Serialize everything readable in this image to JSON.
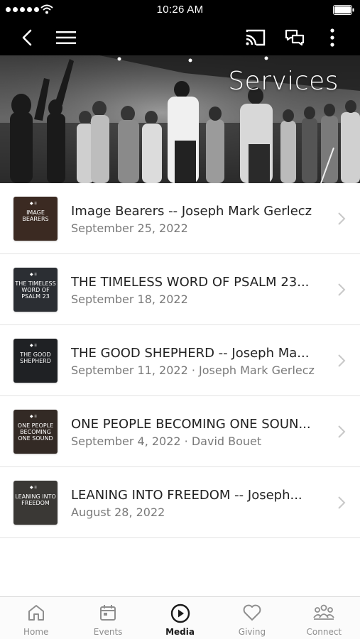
{
  "status_bar": {
    "time": "10:26 AM"
  },
  "page": {
    "title": "Services"
  },
  "items": [
    {
      "title": "Image Bearers -- Joseph Mark Gerlecz",
      "subtitle": "September 25, 2022",
      "thumb_text": "IMAGE BEARERS",
      "thumb_color": "#3b2a22"
    },
    {
      "title": "THE TIMELESS WORD OF PSALM 23...",
      "subtitle": "September 18, 2022",
      "thumb_text": "THE TIMELESS WORD OF PSALM 23",
      "thumb_color": "#2b2e33"
    },
    {
      "title": "THE GOOD SHEPHERD -- Joseph Ma...",
      "subtitle": "September 11, 2022 · Joseph Mark Gerlecz",
      "thumb_text": "THE GOOD SHEPHERD",
      "thumb_color": "#1f2124"
    },
    {
      "title": "ONE PEOPLE BECOMING ONE SOUN...",
      "subtitle": "September 4, 2022 · David Bouet",
      "thumb_text": "ONE PEOPLE BECOMING ONE SOUND",
      "thumb_color": "#332a25"
    },
    {
      "title": "LEANING INTO FREEDOM -- Joseph...",
      "subtitle": "August 28, 2022",
      "thumb_text": "LEANING INTO FREEDOM",
      "thumb_color": "#3a3835"
    }
  ],
  "tabs": [
    {
      "label": "Home",
      "icon": "home-icon",
      "active": false
    },
    {
      "label": "Events",
      "icon": "calendar-icon",
      "active": false
    },
    {
      "label": "Media",
      "icon": "play-circle-icon",
      "active": true
    },
    {
      "label": "Giving",
      "icon": "heart-icon",
      "active": false
    },
    {
      "label": "Connect",
      "icon": "people-icon",
      "active": false
    }
  ],
  "colors": {
    "nav_bg": "#000000",
    "tab_active": "#1a1a1a",
    "tab_inactive": "#8e8e8e",
    "divider": "#e4e4e4"
  }
}
